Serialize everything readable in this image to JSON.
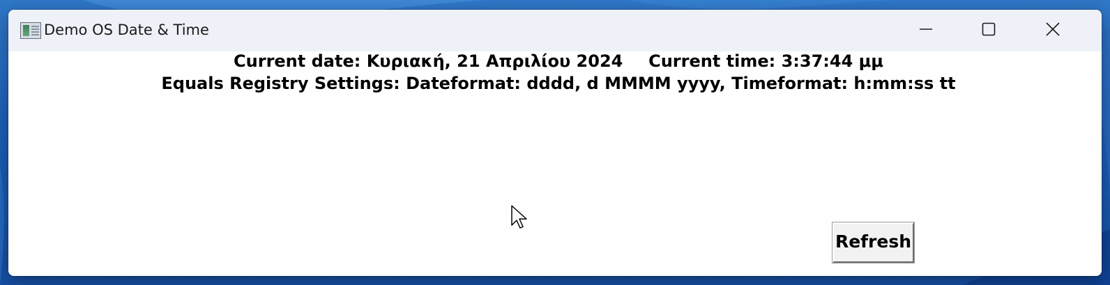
{
  "window": {
    "title": "Demo OS Date & Time",
    "icon": "app-window-icon"
  },
  "titlebar_controls": {
    "minimize_icon": "minimize-icon",
    "maximize_icon": "maximize-icon",
    "close_icon": "close-icon"
  },
  "content": {
    "date_label": "Current date:",
    "date_value": "Κυριακή, 21 Απριλίου 2024",
    "time_label": "Current time:",
    "time_value": "3:37:44 μμ",
    "registry_line": "Equals Registry Settings: Dateformat: dddd, d MMMM yyyy, Timeformat: h:mm:ss tt"
  },
  "buttons": {
    "refresh_label": "Refresh"
  },
  "colors": {
    "titlebar_bg": "#eef2f8",
    "content_bg": "#ffffff",
    "desktop_accent": "#1d5fb8"
  }
}
